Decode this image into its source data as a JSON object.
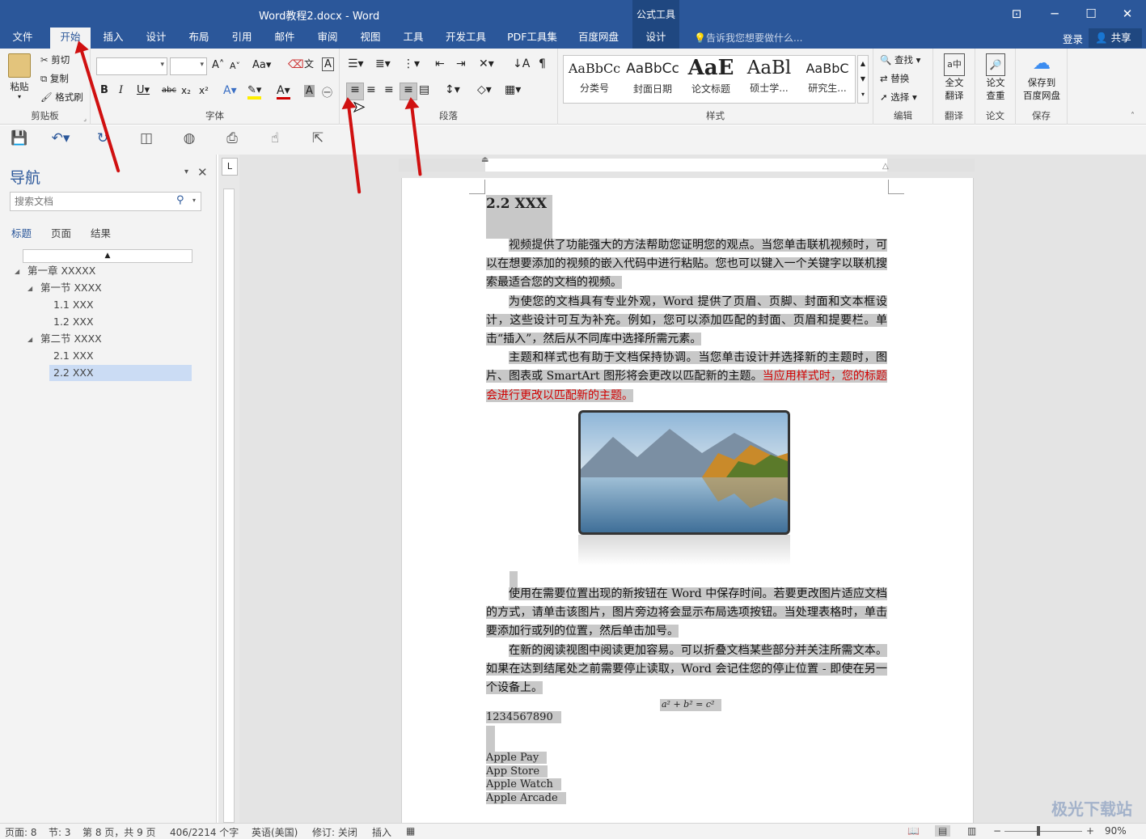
{
  "window": {
    "title": "Word教程2.docx - Word",
    "context_tool": "公式工具"
  },
  "tabs": [
    "文件",
    "开始",
    "插入",
    "设计",
    "布局",
    "引用",
    "邮件",
    "审阅",
    "视图",
    "工具",
    "开发工具",
    "PDF工具集",
    "百度网盘"
  ],
  "context_tab": "设计",
  "tell_me": "告诉我您想要做什么...",
  "account": {
    "login": "登录",
    "share": "共享"
  },
  "ribbon": {
    "clipboard": {
      "paste": "粘贴",
      "cut": "剪切",
      "copy": "复制",
      "format_painter": "格式刷",
      "label": "剪贴板"
    },
    "font": {
      "label": "字体",
      "font_name": "",
      "font_size": ""
    },
    "paragraph": {
      "label": "段落"
    },
    "styles": {
      "label": "样式",
      "items": [
        {
          "preview": "AaBbCc",
          "name": "分类号"
        },
        {
          "preview": "AaBbCc",
          "name": "封面日期"
        },
        {
          "preview": "AaE",
          "name": "论文标题"
        },
        {
          "preview": "AaBl",
          "name": "硕士学..."
        },
        {
          "preview": "AaBbC",
          "name": "研究生..."
        }
      ]
    },
    "editing": {
      "find": "查找",
      "replace": "替换",
      "select": "选择",
      "label": "编辑"
    },
    "translate": {
      "btn": "全文\n翻译",
      "btn_l1": "全文",
      "btn_l2": "翻译",
      "label": "翻译"
    },
    "paper": {
      "btn_l1": "论文",
      "btn_l2": "查重",
      "label": "论文"
    },
    "save": {
      "btn_l1": "保存到",
      "btn_l2": "百度网盘",
      "label": "保存"
    }
  },
  "nav": {
    "title": "导航",
    "search_placeholder": "搜索文档",
    "tabs": [
      "标题",
      "页面",
      "结果"
    ],
    "tree": [
      {
        "text": "第一章 XXXXX",
        "level": 0
      },
      {
        "text": "第一节 XXXX",
        "level": 1
      },
      {
        "text": "1.1 XXX",
        "level": 2
      },
      {
        "text": "1.2 XXX",
        "level": 2
      },
      {
        "text": "第二节 XXXX",
        "level": 1
      },
      {
        "text": "2.1 XXX",
        "level": 2
      },
      {
        "text": "2.2 XXX",
        "level": 2,
        "selected": true
      }
    ]
  },
  "doc": {
    "heading": "2.2 XXX",
    "p1": "视频提供了功能强大的方法帮助您证明您的观点。当您单击联机视频时，可以在想要添加的视频的嵌入代码中进行粘贴。您也可以键入一个关键字以联机搜索最适合您的文档的视频。",
    "p2": "为使您的文档具有专业外观，Word 提供了页眉、页脚、封面和文本框设计，这些设计可互为补充。例如，您可以添加匹配的封面、页眉和提要栏。单击“插入”，然后从不同库中选择所需元素。",
    "p3a": "主题和样式也有助于文档保持协调。当您单击设计并选择新的主题时，图片、图表或 SmartArt 图形将会更改以匹配新的主题。",
    "p3b": "当应用样式时，您的标题会进行更改以匹配新的主题。",
    "p4": "使用在需要位置出现的新按钮在 Word 中保存时间。若要更改图片适应文档的方式，请单击该图片，图片旁边将会显示布局选项按钮。当处理表格时，单击要添加行或列的位置，然后单击加号。",
    "p5": "在新的阅读视图中阅读更加容易。可以折叠文档某些部分并关注所需文本。如果在达到结尾处之前需要停止读取，Word 会记住您的停止位置 - 即使在另一个设备上。",
    "equation": "a² + b² = c²",
    "numbers": "1234567890",
    "list": [
      "Apple Pay",
      "App Store",
      "Apple Watch",
      "Apple Arcade"
    ]
  },
  "status": {
    "page": "页面: 8",
    "section": "节: 3",
    "pages": "第 8 页，共 9 页",
    "words": "406/2214 个字",
    "lang": "英语(美国)",
    "track": "修订: 关闭",
    "insert": "插入",
    "zoom": "90%"
  },
  "watermark": "极光下载站"
}
